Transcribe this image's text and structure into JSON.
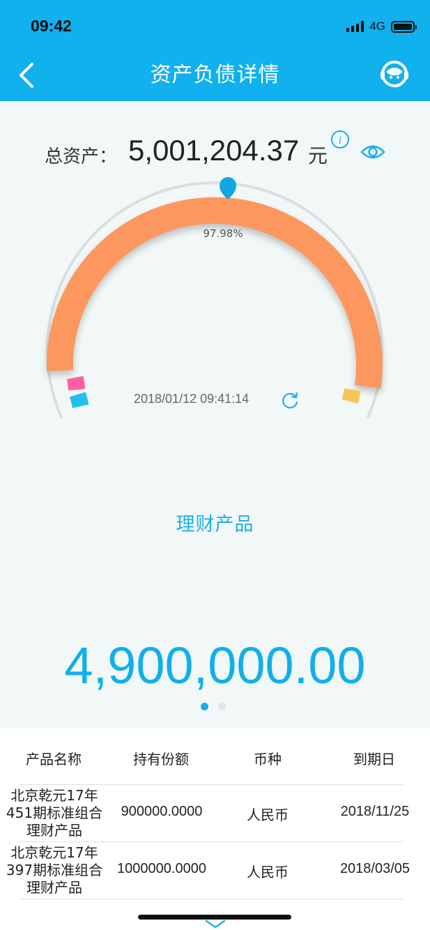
{
  "status_bar": {
    "time": "09:42",
    "network": "4G"
  },
  "nav": {
    "title": "资产负债详情",
    "back_icon": "chevron-left-icon",
    "service_icon": "customer-service-icon"
  },
  "summary": {
    "label": "总资产：",
    "value": "5,001,204.37",
    "unit": "元",
    "info_icon": "info-icon",
    "visibility_icon": "eye-icon"
  },
  "gauge": {
    "percent_label": "97.98%",
    "timestamp": "2018/01/12 09:41:14",
    "segments": [
      {
        "name": "理财产品",
        "share": 0.9798,
        "color": "#fc9760"
      },
      {
        "name": "",
        "color": "#ff5fa0"
      },
      {
        "name": "",
        "color": "#23c0ef"
      },
      {
        "name": "",
        "color": "#f5c75a"
      }
    ]
  },
  "category": {
    "label": "理财产品",
    "amount": "4,900,000.00"
  },
  "pager": {
    "count": 2,
    "active": 0
  },
  "table": {
    "headers": [
      "产品名称",
      "持有份额",
      "币种",
      "到期日"
    ],
    "rows": [
      {
        "name": [
          "北京乾元17年",
          "451期标准组合",
          "理财产品"
        ],
        "shares": "900000.0000",
        "currency": "人民币",
        "maturity": "2018/11/25"
      },
      {
        "name": [
          "北京乾元17年",
          "397期标准组合",
          "理财产品"
        ],
        "shares": "1000000.0000",
        "currency": "人民币",
        "maturity": "2018/03/05"
      }
    ]
  },
  "colors": {
    "brand": "#10b1ec",
    "accent": "#12afe8",
    "gauge_main": "#fc9760"
  }
}
